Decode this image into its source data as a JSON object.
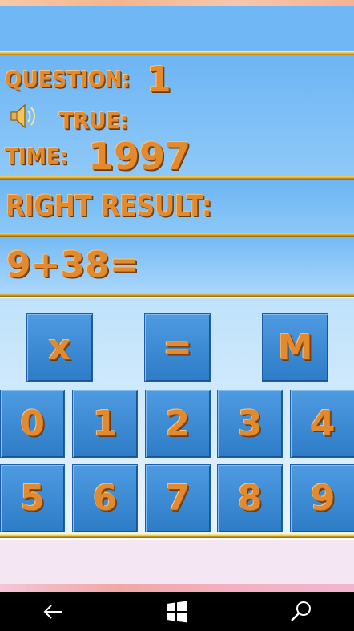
{
  "labels": {
    "question": "QUESTION:",
    "true": "TRUE:",
    "time": "TIME:",
    "right_result": "RIGHT RESULT:"
  },
  "values": {
    "question_number": "1",
    "time": "1997",
    "expression": "9+38="
  },
  "function_keys": [
    "x",
    "=",
    "M"
  ],
  "digit_keys_row1": [
    "0",
    "1",
    "2",
    "3",
    "4"
  ],
  "digit_keys_row2": [
    "5",
    "6",
    "7",
    "8",
    "9"
  ],
  "icons": {
    "sound": "speaker-icon",
    "nav_back": "back-arrow-icon",
    "nav_home": "windows-logo-icon",
    "nav_search": "search-icon"
  },
  "colors": {
    "panel_blue": "#6fb8f5",
    "key_blue": "#3a8bd6",
    "text_orange": "#e28a2d",
    "gold_divider": "#d7a21e"
  }
}
